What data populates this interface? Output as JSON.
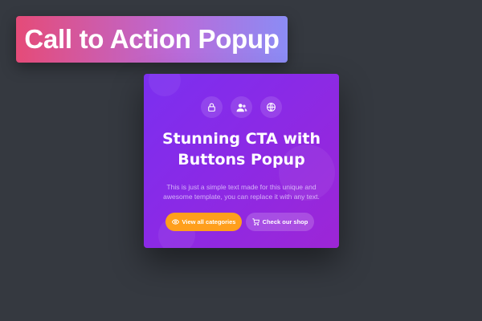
{
  "banner": {
    "title": "Call to Action Popup"
  },
  "popup": {
    "icons": [
      "lock-icon",
      "users-icon",
      "globe-icon"
    ],
    "title_line1": "Stunning CTA with",
    "title_line2": "Buttons Popup",
    "text_line1": "This is just a simple text made for this unique and",
    "text_line2": "awesome template, you can replace it with any text.",
    "primary_button": {
      "label": "View all categories",
      "icon": "eye-icon",
      "color": "#ff9f1c"
    },
    "secondary_button": {
      "label": "Check our shop",
      "icon": "cart-icon"
    }
  },
  "colors": {
    "background": "#353940",
    "popup_start": "#7b2ff0",
    "popup_end": "#9d26d6",
    "banner_start": "#e54b78",
    "banner_end": "#8b8cf5"
  }
}
